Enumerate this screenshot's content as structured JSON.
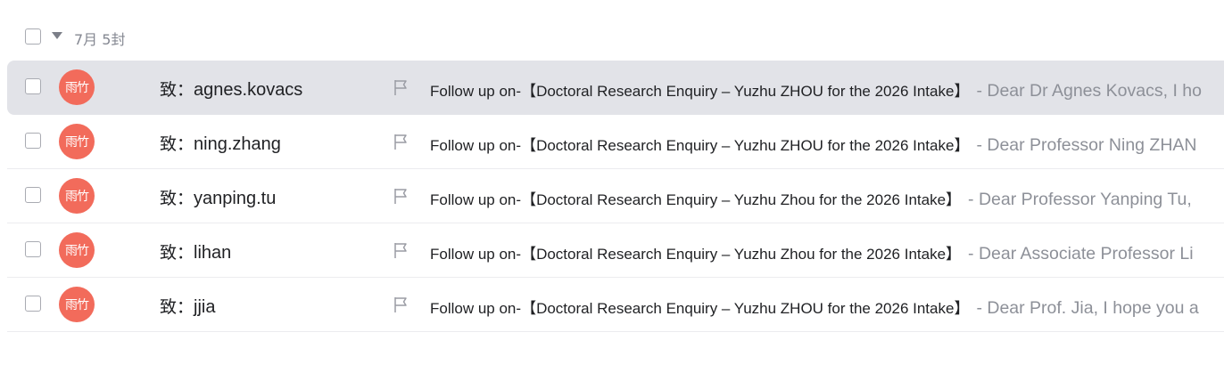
{
  "group": {
    "label": "7月 5封"
  },
  "mails": [
    {
      "avatar_text": "雨竹",
      "to_prefix": "致：",
      "recipient": "agnes.kovacs",
      "subject_prefix": "Follow up on-",
      "subject_open": "【",
      "subject_title": "Doctoral Research Enquiry – Yuzhu ZHOU for the 2026 Intake",
      "subject_close": "】",
      "snippet": "- Dear Dr Agnes Kovacs, I ho",
      "selected": true
    },
    {
      "avatar_text": "雨竹",
      "to_prefix": "致：",
      "recipient": "ning.zhang",
      "subject_prefix": "Follow up on-",
      "subject_open": "【",
      "subject_title": "Doctoral Research Enquiry – Yuzhu ZHOU for the 2026 Intake",
      "subject_close": "】",
      "snippet": "- Dear Professor Ning ZHAN",
      "selected": false
    },
    {
      "avatar_text": "雨竹",
      "to_prefix": "致：",
      "recipient": "yanping.tu",
      "subject_prefix": "Follow up on-",
      "subject_open": "【",
      "subject_title": "Doctoral Research Enquiry – Yuzhu Zhou for the 2026 Intake",
      "subject_close": "】",
      "snippet": "- Dear Professor Yanping Tu,",
      "selected": false
    },
    {
      "avatar_text": "雨竹",
      "to_prefix": "致：",
      "recipient": "lihan",
      "subject_prefix": "Follow up on-",
      "subject_open": "【",
      "subject_title": "Doctoral Research Enquiry – Yuzhu Zhou for the 2026 Intake",
      "subject_close": "】",
      "snippet": "- Dear Associate Professor Li",
      "selected": false
    },
    {
      "avatar_text": "雨竹",
      "to_prefix": "致：",
      "recipient": "jjia",
      "subject_prefix": "Follow up on-",
      "subject_open": "【",
      "subject_title": "Doctoral Research Enquiry – Yuzhu ZHOU for the 2026 Intake",
      "subject_close": "】",
      "snippet": "- Dear Prof. Jia, I hope you a",
      "selected": false
    }
  ],
  "colors": {
    "avatar_bg": "#f26b5b",
    "selected_row_bg": "#e2e3e8",
    "snippet_text": "#8d9098"
  },
  "icons": {
    "flag": "flag-icon",
    "group_toggle": "caret-down-icon"
  }
}
